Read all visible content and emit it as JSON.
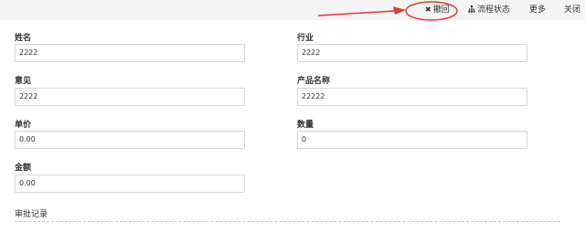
{
  "toolbar": {
    "withdraw_label": "撤回",
    "flow_status_label": "流程状态",
    "more_label": "更多",
    "close_label": "关闭",
    "withdraw_icon": "close-x-icon",
    "flow_icon": "sitemap-icon"
  },
  "form": {
    "name": {
      "label": "姓名",
      "value": "2222"
    },
    "industry": {
      "label": "行业",
      "value": "2222"
    },
    "opinion": {
      "label": "意见",
      "value": "2222"
    },
    "product_name": {
      "label": "产品名称",
      "value": "22222"
    },
    "unit_price": {
      "label": "单价",
      "value": "0.00"
    },
    "quantity": {
      "label": "数量",
      "value": "0"
    },
    "amount": {
      "label": "金额",
      "value": "0.00"
    }
  },
  "approval_section": {
    "title": "审批记录"
  },
  "colors": {
    "annotation": "#e53935",
    "toolbar_bg": "#f4f4f4",
    "field_border": "#d6d6d6"
  }
}
